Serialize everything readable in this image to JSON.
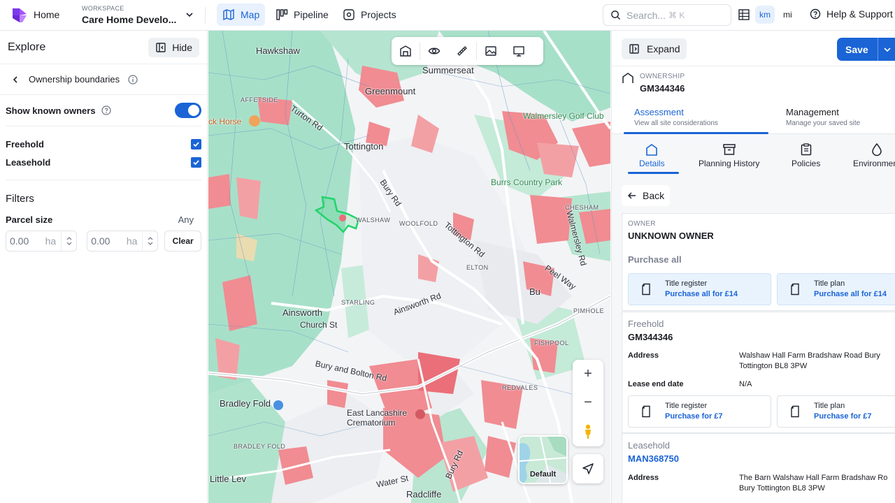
{
  "topbar": {
    "home_label": "Home",
    "workspace_caption": "WORKSPACE",
    "workspace_name": "Care Home Develo...",
    "nav": [
      {
        "label": "Map"
      },
      {
        "label": "Pipeline"
      },
      {
        "label": "Projects"
      }
    ],
    "search_placeholder": "Search...",
    "search_shortcut": "⌘ K",
    "units": [
      "km",
      "mi"
    ],
    "selected_unit": "km",
    "help_label": "Help & Support"
  },
  "left_panel": {
    "title": "Explore",
    "hide_label": "Hide",
    "layer_name": "Ownership boundaries",
    "show_known_owners_label": "Show known owners",
    "show_known_owners_on": true,
    "freehold_label": "Freehold",
    "freehold_checked": true,
    "leasehold_label": "Leasehold",
    "leasehold_checked": true,
    "filters_title": "Filters",
    "parcel_size_label": "Parcel size",
    "parcel_size_value": "Any",
    "min_value": "0.00",
    "max_value": "0.00",
    "unit": "ha",
    "clear_label": "Clear"
  },
  "map": {
    "places": {
      "hawkshaw": "Hawkshaw",
      "summerseat": "Summerseat",
      "greenmount": "Greenmount",
      "affetside": "AFFETSIDE",
      "turton_rd": "Turton Rd",
      "tottington": "Tottington",
      "tottington_rd": "Tottington Rd",
      "horse": "ck Horse",
      "walmersley_golf": "Walmersley Golf Club",
      "burrs_country_park": "Burrs Country Park",
      "chesham": "CHESHAM",
      "elton": "ELTON",
      "woolfold": "WOOLFOLD",
      "walshaw": "WALSHAW",
      "walmersley_rd": "Walmersley Rd",
      "ainsworth": "Ainsworth",
      "ainsworth_rd": "Ainsworth Rd",
      "starling": "STARLING",
      "bury": "Bu",
      "pimhole": "PIMHOLE",
      "fishpool": "FISHPOOL",
      "redvales": "REDVALES",
      "bury_and_bolton_rd": "Bury and Bolton Rd",
      "bradley_fold": "Bradley Fold",
      "east_lancashire": "East Lancashire Crematorium",
      "radcliffe": "Radcliffe",
      "little_lever": "Little Lev",
      "water_st": "Water St",
      "bury_rd": "Bury Rd",
      "church_st": "Church St",
      "peel_way": "Peel Way",
      "bradley_fold_small": "BRADLEY FOLD"
    },
    "basemap_label": "Default",
    "zoom_in": "+",
    "zoom_out": "−"
  },
  "right_panel": {
    "expand_label": "Expand",
    "save_label": "Save",
    "ownership_caption": "OWNERSHIP",
    "ownership_id": "GM344346",
    "segments": [
      {
        "title": "Assessment",
        "subtitle": "View all site considerations"
      },
      {
        "title": "Management",
        "subtitle": "Manage your saved site"
      }
    ],
    "tabs": [
      {
        "label": "Details"
      },
      {
        "label": "Planning History"
      },
      {
        "label": "Policies"
      },
      {
        "label": "Environment"
      }
    ],
    "back_label": "Back",
    "owner_caption": "OWNER",
    "owner_name": "UNKNOWN OWNER",
    "purchase_all_label": "Purchase all",
    "purchase_all_cards": [
      {
        "title": "Title register",
        "link": "Purchase all for £14"
      },
      {
        "title": "Title plan",
        "link": "Purchase all for £14"
      }
    ],
    "freehold": {
      "label": "Freehold",
      "id": "GM344346",
      "address_label": "Address",
      "address": "Walshaw Hall Farm Bradshaw Road Bury Tottington BL8 3PW",
      "lease_end_label": "Lease end date",
      "lease_end": "N/A",
      "cards": [
        {
          "title": "Title register",
          "link": "Purchase for £7"
        },
        {
          "title": "Title plan",
          "link": "Purchase for £7"
        }
      ]
    },
    "leasehold": {
      "label": "Leasehold",
      "id": "MAN368750",
      "address_label": "Address",
      "address": "The Barn Walshaw Hall Farm Bradshaw Ro Bury Tottington BL8 3PW"
    }
  },
  "colors": {
    "accent": "#1a64d6",
    "map_freehold_teal": "#9fdcc4",
    "map_leasehold_red": "#f08c92",
    "selection_outline": "#22d46b"
  }
}
